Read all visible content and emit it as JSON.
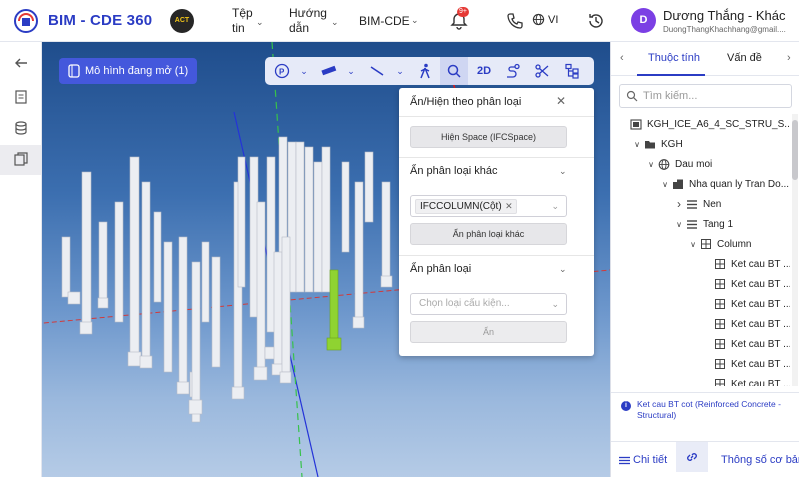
{
  "header": {
    "brand": "BIM - CDE 360",
    "org_logo_text": "ACT",
    "menu_file": "Tệp tin",
    "menu_guide": "Hướng dẫn",
    "menu_bim": "BIM-CDE",
    "notification_count": "9+",
    "language": "VI",
    "user_initial": "D",
    "user_name": "Dương Thắng - Khác",
    "user_email": "DuongThangKhachhang@gmail...."
  },
  "viewer": {
    "opened_models_label": "Mô hình đang mở (1)",
    "toolbar_2d": "2D"
  },
  "filter_panel": {
    "title": "Ẩn/Hiện theo phân loại",
    "show_space_button": "Hiện Space (IFCSpace)",
    "section_hide_other": "Ẩn phân loại khác",
    "selected_tag": "IFCCOLUMN(Cột)",
    "hide_other_button": "Ẩn phân loại khác",
    "section_hide": "Ẩn phân loại",
    "select_placeholder": "Chọn loại cấu kiện...",
    "hide_button": "Ẩn"
  },
  "right_panel": {
    "tab_properties": "Thuộc tính",
    "tab_issues": "Vấn đề",
    "search_placeholder": "Tìm kiếm...",
    "tree": [
      {
        "label": "KGH_ICE_A6_4_SC_STRU_S...",
        "depth": 0,
        "chev": "",
        "icon": "model"
      },
      {
        "label": "KGH",
        "depth": 1,
        "chev": "v",
        "icon": "folder"
      },
      {
        "label": "Dau moi",
        "depth": 2,
        "chev": "v",
        "icon": "globe"
      },
      {
        "label": "Nha quan ly Tran Do...",
        "depth": 3,
        "chev": "v",
        "icon": "building"
      },
      {
        "label": "Nen",
        "depth": 4,
        "chev": ">",
        "icon": "level"
      },
      {
        "label": "Tang 1",
        "depth": 4,
        "chev": "v",
        "icon": "level"
      },
      {
        "label": "Column",
        "depth": 5,
        "chev": "v",
        "icon": "grid"
      },
      {
        "label": "Ket cau BT ...",
        "depth": 6,
        "chev": "",
        "icon": "grid"
      },
      {
        "label": "Ket cau BT ...",
        "depth": 6,
        "chev": "",
        "icon": "grid"
      },
      {
        "label": "Ket cau BT ...",
        "depth": 6,
        "chev": "",
        "icon": "grid"
      },
      {
        "label": "Ket cau BT ...",
        "depth": 6,
        "chev": "",
        "icon": "grid"
      },
      {
        "label": "Ket cau BT ...",
        "depth": 6,
        "chev": "",
        "icon": "grid"
      },
      {
        "label": "Ket cau BT ...",
        "depth": 6,
        "chev": "",
        "icon": "grid"
      },
      {
        "label": "Ket cau BT ...",
        "depth": 6,
        "chev": "",
        "icon": "grid"
      }
    ],
    "info_text": "Ket cau BT cot (Reinforced Concrete - Structural)",
    "bottom_tab_detail": "Chi tiết",
    "bottom_tab_basic": "Thông số cơ bản"
  }
}
